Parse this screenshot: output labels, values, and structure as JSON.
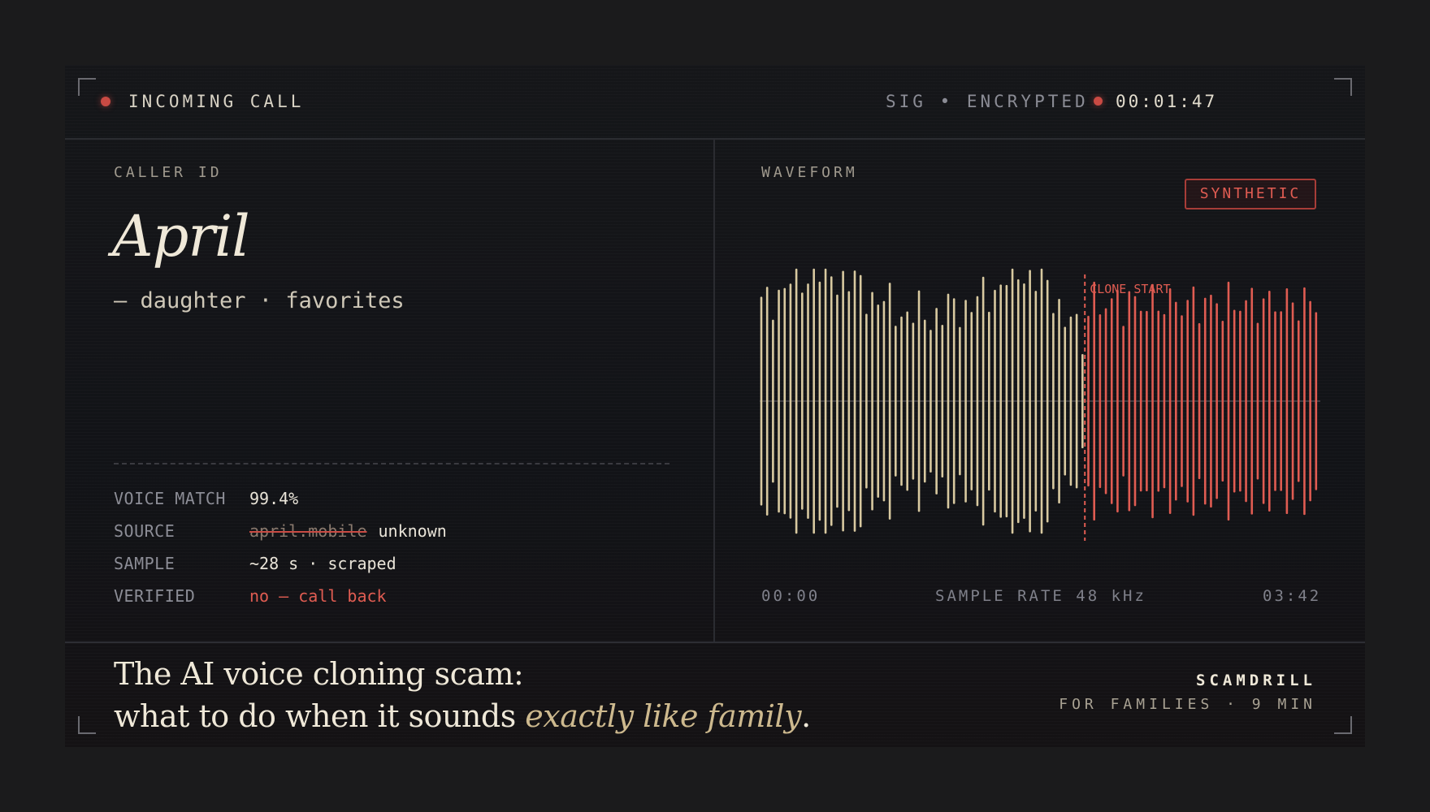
{
  "header": {
    "status": "INCOMING CALL",
    "signal": "SIG • ENCRYPTED",
    "timer": "00:01:47"
  },
  "caller": {
    "section_label": "CALLER ID",
    "name": "April",
    "relation": "— daughter · favorites"
  },
  "details": [
    {
      "key": "VOICE MATCH",
      "value": "99.4%"
    },
    {
      "key": "SOURCE",
      "struck_value": "april.mobile",
      "value": "unknown"
    },
    {
      "key": "SAMPLE",
      "value": "~28 s · scraped"
    },
    {
      "key": "VERIFIED",
      "value": "no — call back"
    }
  ],
  "waveform": {
    "section_label": "WAVEFORM",
    "badge": "SYNTHETIC",
    "marker_label": "CLONE START",
    "clone_start_fraction": 0.58,
    "start_time": "00:00",
    "sample_rate": "SAMPLE RATE 48 kHz",
    "end_time": "03:42"
  },
  "headline": {
    "line1": "The AI voice cloning scam:",
    "line2_prefix": "what to do when it sounds ",
    "line2_emphasis": "exactly like family",
    "line2_suffix": "."
  },
  "brand": {
    "name": "SCAMDRILL",
    "tagline": "FOR FAMILIES · 9 MIN"
  },
  "colors": {
    "alert": "#e05c52",
    "natural_wave": "#d8c9a0",
    "synthetic_wave": "#e05c52",
    "text": "#efe8d8"
  }
}
